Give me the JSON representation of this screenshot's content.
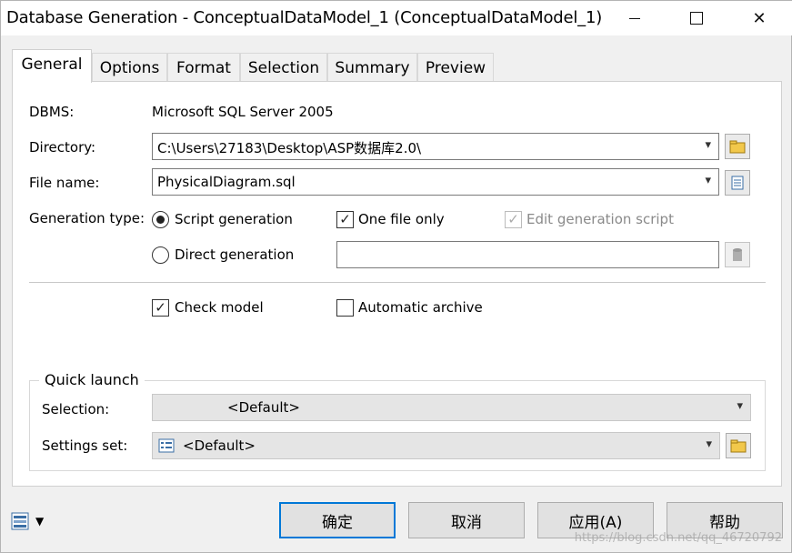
{
  "window": {
    "title": "Database Generation - ConceptualDataModel_1 (ConceptualDataModel_1)",
    "minimize_glyph": "—",
    "maximize_glyph": "☐",
    "close_glyph": "✕"
  },
  "tabs": [
    {
      "label": "General",
      "active": true
    },
    {
      "label": "Options"
    },
    {
      "label": "Format"
    },
    {
      "label": "Selection"
    },
    {
      "label": "Summary"
    },
    {
      "label": "Preview"
    }
  ],
  "general": {
    "dbms_label": "DBMS:",
    "dbms_value": "Microsoft SQL Server 2005",
    "directory_label": "Directory:",
    "directory_value": "C:\\Users\\27183\\Desktop\\ASP数据库2.0\\",
    "filename_label": "File name:",
    "filename_value": "PhysicalDiagram.sql",
    "gen_type_label": "Generation type:",
    "script_generation": "Script generation",
    "direct_generation": "Direct generation",
    "one_file_only": "One file only",
    "edit_generation_script": "Edit generation script",
    "check_model": "Check model",
    "automatic_archive": "Automatic archive"
  },
  "quick_launch": {
    "legend": "Quick launch",
    "selection_label": "Selection:",
    "selection_value": "<Default>",
    "settings_label": "Settings set:",
    "settings_value": "<Default>"
  },
  "buttons": {
    "ok": "确定",
    "cancel": "取消",
    "apply": "应用(A)",
    "help": "帮助"
  },
  "watermark": "https://blog.csdn.net/qq_46720792",
  "icons": {
    "chevron": "▾",
    "check": "✓",
    "dropdown_arrow": "▼"
  }
}
